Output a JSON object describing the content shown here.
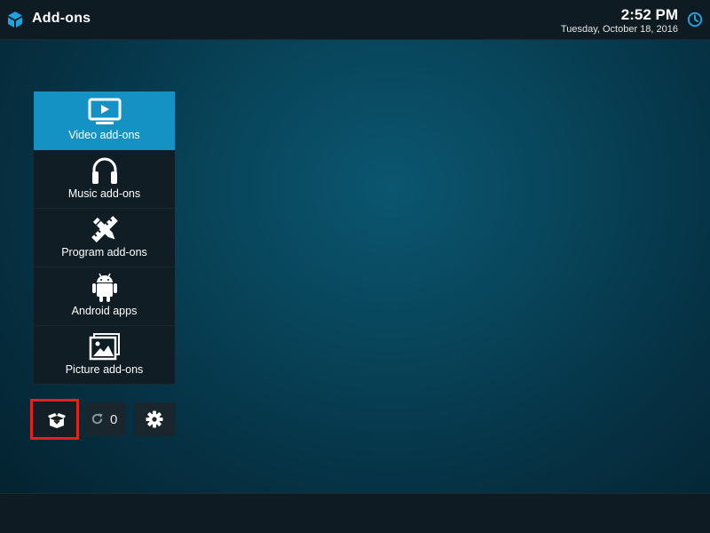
{
  "header": {
    "title": "Add-ons",
    "logo_icon": "addons-box-icon",
    "time": "2:52 PM",
    "date": "Tuesday, October 18, 2016",
    "clock_icon": "clock-icon"
  },
  "menu": {
    "items": [
      {
        "label": "Video add-ons",
        "icon": "video-tv-icon",
        "active": true
      },
      {
        "label": "Music add-ons",
        "icon": "headphones-icon",
        "active": false
      },
      {
        "label": "Program add-ons",
        "icon": "pencil-ruler-icon",
        "active": false
      },
      {
        "label": "Android apps",
        "icon": "android-icon",
        "active": false
      },
      {
        "label": "Picture add-ons",
        "icon": "picture-icon",
        "active": false
      }
    ]
  },
  "actions": {
    "install_icon": "open-box-install-icon",
    "update_icon": "refresh-icon",
    "update_count": "0",
    "settings_icon": "gear-icon"
  },
  "colors": {
    "accent": "#1492c4",
    "highlight_border": "#e2231a",
    "bar_background": "#0f1b22"
  }
}
